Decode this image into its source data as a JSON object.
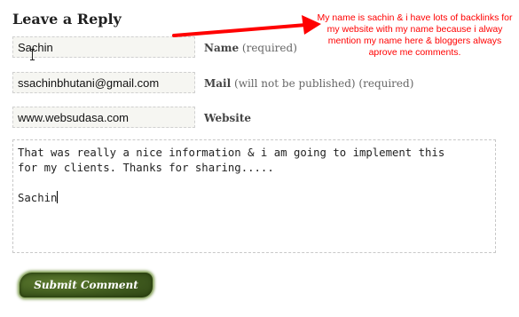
{
  "form": {
    "heading": "Leave a Reply",
    "name": {
      "value": "Sachin",
      "label": "Name",
      "hint": "(required)"
    },
    "mail": {
      "value": "ssachinbhutani@gmail.com",
      "label": "Mail",
      "hint": "(will not be published) (required)"
    },
    "website": {
      "value": "www.websudasa.com",
      "label": "Website"
    },
    "comment": {
      "line1": "That was really a nice information & i am going to implement this",
      "line2": "for my clients. Thanks for sharing.....",
      "signature": "Sachin"
    },
    "submit_label": "Submit Comment"
  },
  "annotation": {
    "text": "My name is sachin & i have lots of backlinks for my website with my name because i alway mention my name here & bloggers always aprove me comments.",
    "color": "#ff0000"
  }
}
